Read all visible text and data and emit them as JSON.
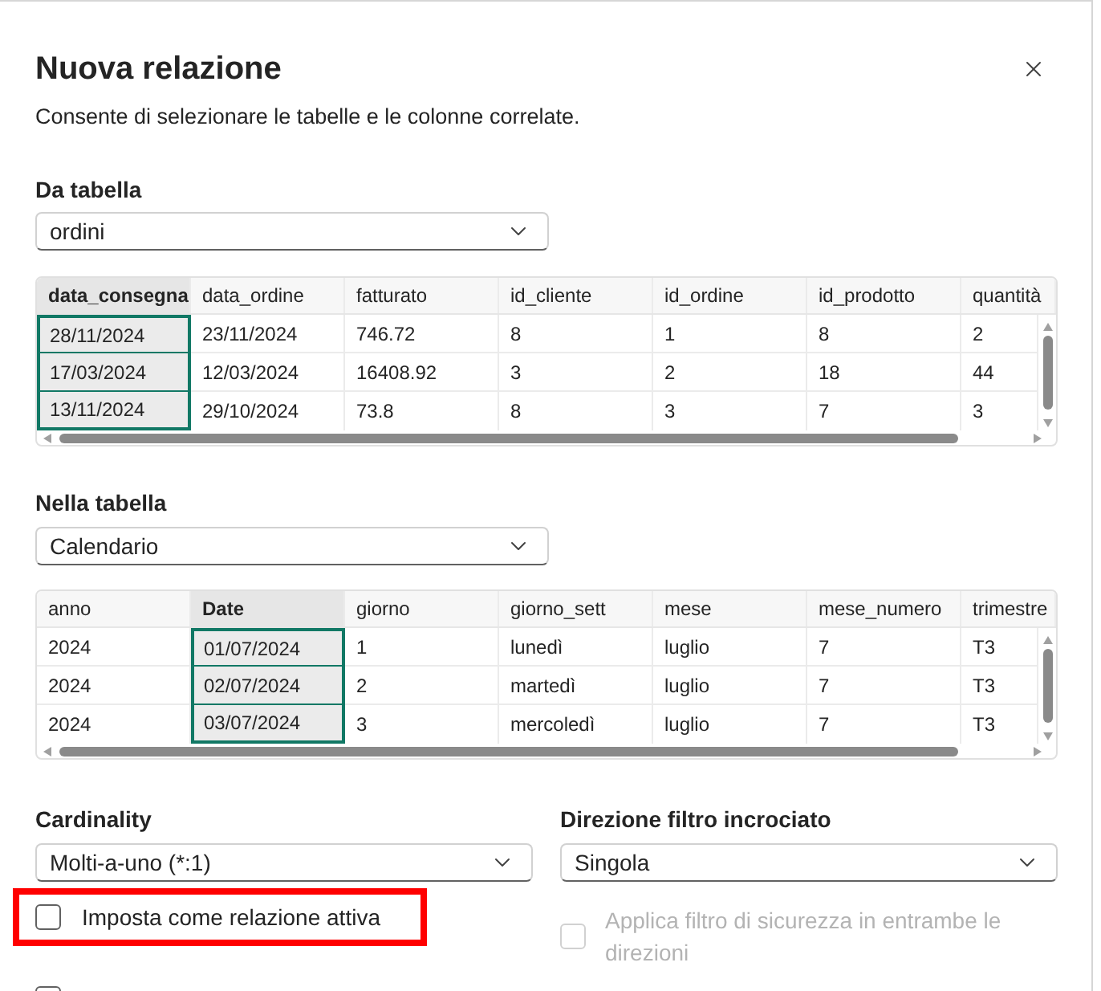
{
  "dialog": {
    "title": "Nuova relazione",
    "description": "Consente di selezionare le tabelle e le colonne correlate."
  },
  "from_table": {
    "label": "Da tabella",
    "value": "ordini",
    "columns": [
      {
        "name": "data_consegna",
        "selected": true
      },
      {
        "name": "data_ordine",
        "selected": false
      },
      {
        "name": "fatturato",
        "selected": false
      },
      {
        "name": "id_cliente",
        "selected": false
      },
      {
        "name": "id_ordine",
        "selected": false
      },
      {
        "name": "id_prodotto",
        "selected": false
      },
      {
        "name": "quantità",
        "selected": false
      }
    ],
    "rows": [
      [
        "28/11/2024",
        "23/11/2024",
        "746.72",
        "8",
        "1",
        "8",
        "2"
      ],
      [
        "17/03/2024",
        "12/03/2024",
        "16408.92",
        "3",
        "2",
        "18",
        "44"
      ],
      [
        "13/11/2024",
        "29/10/2024",
        "73.8",
        "8",
        "3",
        "7",
        "3"
      ]
    ]
  },
  "to_table": {
    "label": "Nella tabella",
    "value": "Calendario",
    "columns": [
      {
        "name": "anno",
        "selected": false
      },
      {
        "name": "Date",
        "selected": true
      },
      {
        "name": "giorno",
        "selected": false
      },
      {
        "name": "giorno_sett",
        "selected": false
      },
      {
        "name": "mese",
        "selected": false
      },
      {
        "name": "mese_numero",
        "selected": false
      },
      {
        "name": "trimestre",
        "selected": false
      }
    ],
    "rows": [
      [
        "2024",
        "01/07/2024",
        "1",
        "lunedì",
        "luglio",
        "7",
        "T3"
      ],
      [
        "2024",
        "02/07/2024",
        "2",
        "martedì",
        "luglio",
        "7",
        "T3"
      ],
      [
        "2024",
        "03/07/2024",
        "3",
        "mercoledì",
        "luglio",
        "7",
        "T3"
      ]
    ]
  },
  "cardinality": {
    "label": "Cardinality",
    "value": "Molti-a-uno (*:1)"
  },
  "cross_filter_direction": {
    "label": "Direzione filtro incrociato",
    "value": "Singola"
  },
  "options": [
    {
      "label": "Imposta come relazione attiva",
      "checked": false,
      "disabled": false,
      "highlighted": true
    },
    {
      "label": "Applica filtro di sicurezza in entrambe le direzioni",
      "checked": false,
      "disabled": true,
      "highlighted": false
    },
    {
      "checked": false,
      "disabled": false,
      "highlighted": false
    }
  ]
}
